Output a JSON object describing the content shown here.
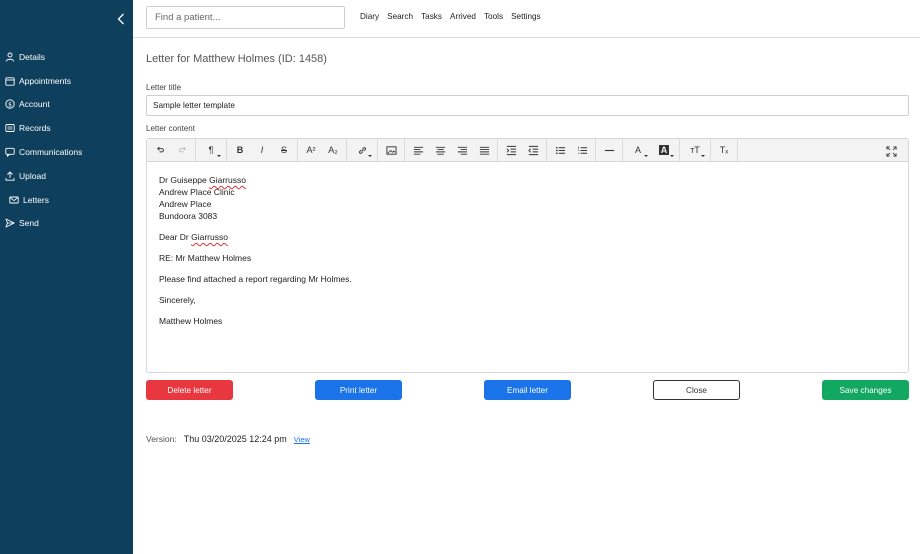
{
  "sidebar": {
    "items": [
      {
        "label": "Details",
        "icon": "user-icon"
      },
      {
        "label": "Appointments",
        "icon": "calendar-icon"
      },
      {
        "label": "Account",
        "icon": "dollar-icon"
      },
      {
        "label": "Records",
        "icon": "records-icon"
      },
      {
        "label": "Communications",
        "icon": "chat-icon"
      },
      {
        "label": "Upload",
        "icon": "upload-icon"
      },
      {
        "label": "Letters",
        "icon": "envelope-icon"
      },
      {
        "label": "Send",
        "icon": "send-icon"
      }
    ]
  },
  "topbar": {
    "search_placeholder": "Find a patient...",
    "nav": [
      "Diary",
      "Search",
      "Tasks",
      "Arrived",
      "Tools",
      "Settings"
    ]
  },
  "main": {
    "heading": "Letter for Matthew Holmes (ID: 1458)",
    "title_label": "Letter title",
    "title_value": "Sample letter template",
    "content_label": "Letter content"
  },
  "letter": {
    "addr1_first": "Dr Guiseppe ",
    "addr1_last": "Giarrusso",
    "addr2": "Andrew Place Clinic",
    "addr3": "Andrew Place",
    "addr4": "Bundoora 3083",
    "greeting_prefix": "Dear Dr ",
    "greeting_name": "Giarrusso",
    "re": "RE: Mr Matthew Holmes",
    "body": "Please find attached a report regarding Mr Holmes.",
    "closing": "Sincerely,",
    "signature": "Matthew Holmes"
  },
  "toolbar": {
    "undo": "↶",
    "redo": "↷",
    "paragraph": "¶",
    "bold": "B",
    "italic": "I",
    "strike": "S",
    "superscript": "A²",
    "subscript": "A₂",
    "font_color": "A",
    "bg_color": "A",
    "font_size": "ᴛT",
    "clear_format": "Tₓ"
  },
  "buttons": {
    "delete": "Delete letter",
    "print": "Print letter",
    "email": "Email letter",
    "close": "Close",
    "save": "Save changes"
  },
  "version": {
    "label": "Version:",
    "timestamp": "Thu 03/20/2025 12:24 pm",
    "view": "View"
  },
  "colors": {
    "sidebar": "#0e3f5c",
    "delete": "#e8373f",
    "primary": "#1a73e8",
    "save": "#12a862"
  }
}
